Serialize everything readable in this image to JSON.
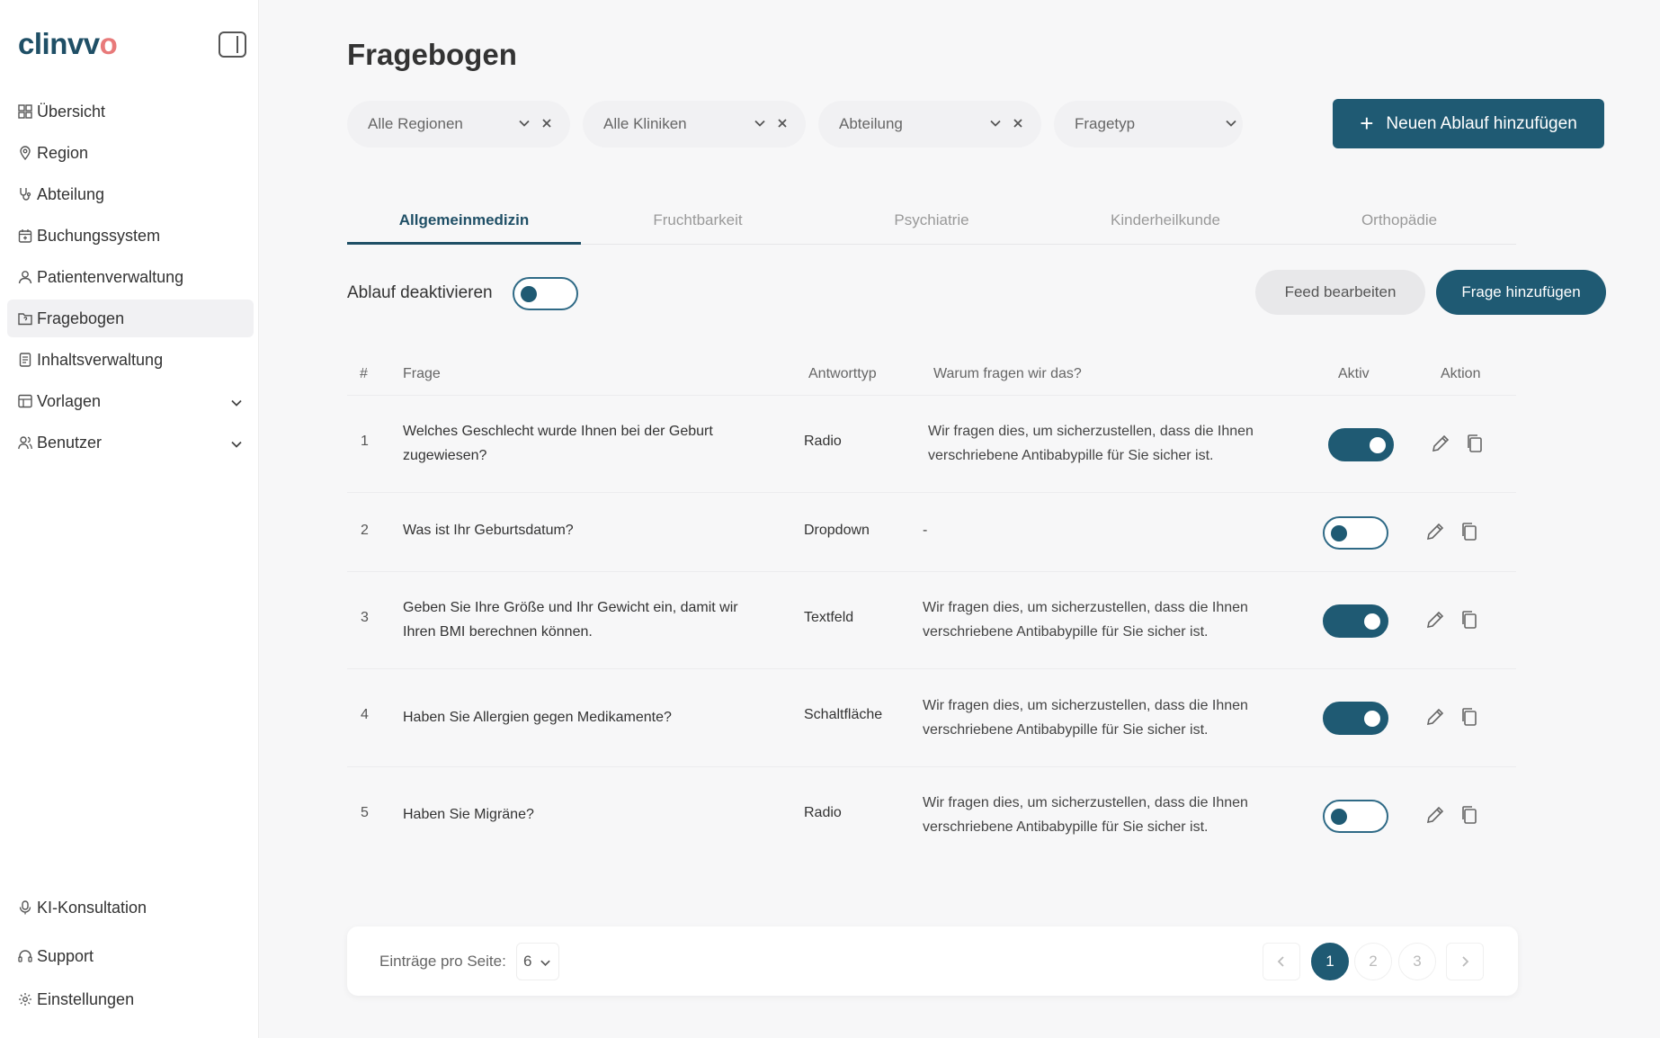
{
  "app": {
    "logo_main": "clinvv",
    "logo_accent": "o"
  },
  "sidebar": {
    "items": [
      {
        "label": "Übersicht",
        "icon": "dashboard-icon"
      },
      {
        "label": "Region",
        "icon": "map-pin-icon"
      },
      {
        "label": "Abteilung",
        "icon": "stethoscope-icon"
      },
      {
        "label": "Buchungssystem",
        "icon": "calendar-icon"
      },
      {
        "label": "Patientenverwaltung",
        "icon": "user-icon"
      },
      {
        "label": "Fragebogen",
        "icon": "folder-question-icon",
        "active": true
      },
      {
        "label": "Inhaltsverwaltung",
        "icon": "document-icon"
      },
      {
        "label": "Vorlagen",
        "icon": "table-icon",
        "expandable": true
      },
      {
        "label": "Benutzer",
        "icon": "users-icon",
        "expandable": true
      }
    ],
    "bottom": [
      {
        "label": "KI-Konsultation",
        "icon": "microphone-icon"
      },
      {
        "label": "Support",
        "icon": "headset-icon"
      },
      {
        "label": "Einstellungen",
        "icon": "gear-icon"
      }
    ]
  },
  "page": {
    "title": "Fragebogen"
  },
  "filters": {
    "region": "Alle Regionen",
    "clinic": "Alle Kliniken",
    "department": "Abteilung",
    "question_type": "Fragetyp",
    "add_flow": "Neuen Ablauf hinzufügen"
  },
  "tabs": [
    "Allgemeinmedizin",
    "Fruchtbarkeit",
    "Psychiatrie",
    "Kinderheilkunde",
    "Orthopädie"
  ],
  "toolbar": {
    "deactivate_label": "Ablauf deaktivieren",
    "deactivate_state": false,
    "edit_feed": "Feed bearbeiten",
    "add_question": "Frage hinzufügen"
  },
  "table": {
    "headers": {
      "num": "#",
      "question": "Frage",
      "answer_type": "Antworttyp",
      "why": "Warum fragen wir das?",
      "active": "Aktiv",
      "action": "Aktion"
    },
    "rows": [
      {
        "num": "1",
        "question": "Welches Geschlecht wurde Ihnen bei der Geburt zugewiesen?",
        "type": "Radio",
        "why": "Wir fragen dies, um sicherzustellen, dass die Ihnen verschriebene Antibabypille für Sie sicher ist.",
        "active": true
      },
      {
        "num": "2",
        "question": "Was ist Ihr Geburtsdatum?",
        "type": "Dropdown",
        "why": "-",
        "active": false
      },
      {
        "num": "3",
        "question": "Geben Sie Ihre Größe und Ihr Gewicht ein, damit wir Ihren BMI berechnen können.",
        "type": "Textfeld",
        "why": "Wir fragen dies, um sicherzustellen, dass die Ihnen verschriebene Antibabypille für Sie sicher ist.",
        "active": true
      },
      {
        "num": "4",
        "question": "Haben Sie Allergien gegen Medikamente?",
        "type": "Schaltfläche",
        "why": "Wir fragen dies, um sicherzustellen, dass die Ihnen verschriebene Antibabypille für Sie sicher ist.",
        "active": true
      },
      {
        "num": "5",
        "question": "Haben Sie Migräne?",
        "type": "Radio",
        "why": "Wir fragen dies, um sicherzustellen, dass die Ihnen verschriebene Antibabypille für Sie sicher ist.",
        "active": false
      }
    ]
  },
  "pagination": {
    "per_page_label": "Einträge pro Seite:",
    "per_page_value": "6",
    "pages": [
      "1",
      "2",
      "3"
    ],
    "current": "1"
  }
}
